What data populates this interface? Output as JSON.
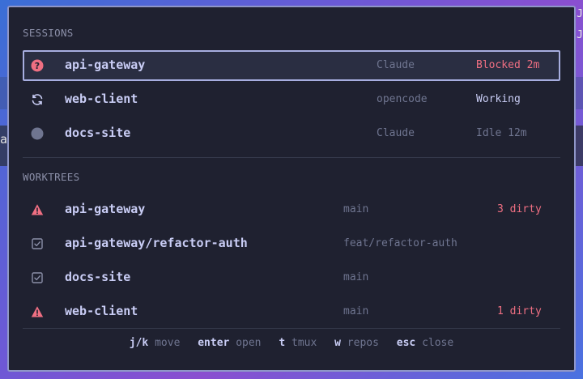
{
  "background": {
    "left_glyph": "a",
    "right_glyph_top": "J",
    "right_glyph": "J"
  },
  "colors": {
    "modal_bg": "#1f2130",
    "accent_border": "#a7aee0",
    "blocked": "#ef6f82",
    "dirty": "#ef6f82",
    "working": "#c9cdf5",
    "idle": "#6f7590",
    "muted": "#6f7590"
  },
  "sessions": {
    "header": "SESSIONS",
    "items": [
      {
        "icon": "question-circle-icon",
        "name": "api-gateway",
        "agent": "Claude",
        "status": "Blocked 2m",
        "status_kind": "blocked"
      },
      {
        "icon": "refresh-icon",
        "name": "web-client",
        "agent": "opencode",
        "status": "Working",
        "status_kind": "working"
      },
      {
        "icon": "idle-dot-icon",
        "name": "docs-site",
        "agent": "Claude",
        "status": "Idle 12m",
        "status_kind": "idle"
      }
    ]
  },
  "worktrees": {
    "header": "WORKTREES",
    "items": [
      {
        "icon": "warning-icon",
        "name": "api-gateway",
        "branch": "main",
        "status": "3 dirty"
      },
      {
        "icon": "checkbox-icon",
        "name": "api-gateway/refactor-auth",
        "branch": "feat/refactor-auth",
        "status": ""
      },
      {
        "icon": "checkbox-icon",
        "name": "docs-site",
        "branch": "main",
        "status": ""
      },
      {
        "icon": "warning-icon",
        "name": "web-client",
        "branch": "main",
        "status": "1 dirty"
      }
    ]
  },
  "footer": {
    "hints": [
      {
        "key": "j/k",
        "desc": "move"
      },
      {
        "key": "enter",
        "desc": "open"
      },
      {
        "key": "t",
        "desc": "tmux"
      },
      {
        "key": "w",
        "desc": "repos"
      },
      {
        "key": "esc",
        "desc": "close"
      }
    ]
  }
}
